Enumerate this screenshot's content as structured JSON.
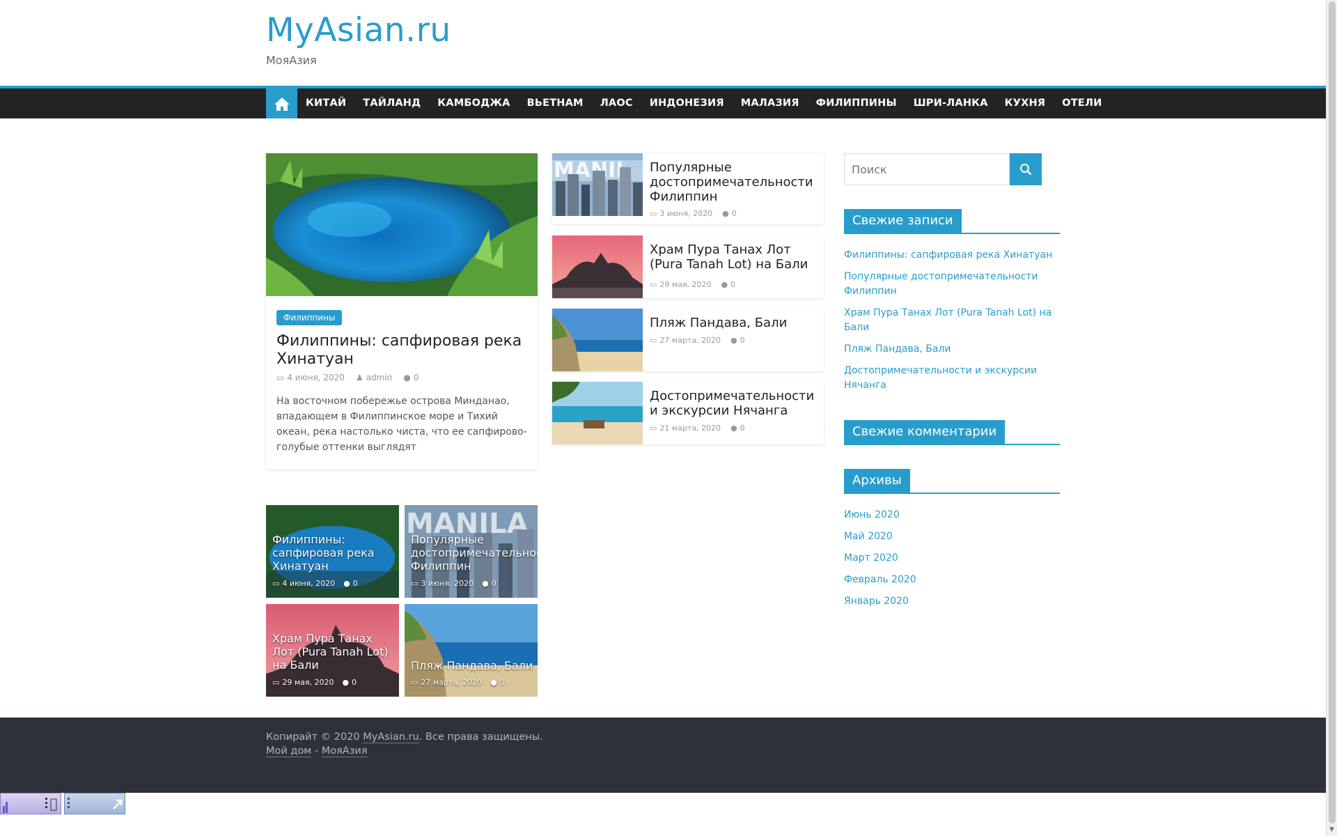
{
  "site": {
    "title": "MyAsian.ru",
    "description": "МояАзия"
  },
  "nav": {
    "items": [
      "КИТАЙ",
      "ТАЙЛАНД",
      "КАМБОДЖА",
      "ВЬЕТНАМ",
      "ЛАОС",
      "ИНДОНЕЗИЯ",
      "МАЛАЗИЯ",
      "ФИЛИППИНЫ",
      "ШРИ-ЛАНКА",
      "КУХНЯ",
      "ОТЕЛИ"
    ]
  },
  "featured": {
    "category": "Филиппины",
    "title": "Филиппины: сапфировая река Хинатуан",
    "date": "4 июня, 2020",
    "author": "admin",
    "comments": "0",
    "excerpt": "На восточном побережье острова Минданао, впадающем в Филиппинское море и Тихий океан, река настолько чиста, что ее сапфирово-голубые оттенки выглядят"
  },
  "side_posts": [
    {
      "title": "Популярные достопримечательности Филиппин",
      "date": "3 июня, 2020",
      "comments": "0"
    },
    {
      "title": "Храм Пура Танах Лот (Pura Tanah Lot) на Бали",
      "date": "29 мая, 2020",
      "comments": "0"
    },
    {
      "title": "Пляж Пандава, Бали",
      "date": "27 марта, 2020",
      "comments": "0"
    },
    {
      "title": "Достопримечательности и экскурсии Нячанга",
      "date": "21 марта, 2020",
      "comments": "0"
    }
  ],
  "grid_posts": [
    {
      "title": "Филиппины: сапфировая река Хинатуан",
      "date": "4 июня, 2020",
      "comments": "0"
    },
    {
      "title": "Популярные достопримечательности Филиппин",
      "date": "3 июня, 2020",
      "comments": "0"
    },
    {
      "title": "Храм Пура Танах Лот (Pura Tanah Lot) на Бали",
      "date": "29 мая, 2020",
      "comments": "0"
    },
    {
      "title": "Пляж Пандава, Бали",
      "date": "27 марта, 2020",
      "comments": "0"
    }
  ],
  "sidebar": {
    "search_placeholder": "Поиск",
    "recent_posts_title": "Свежие записи",
    "recent_posts": [
      "Филиппины: сапфировая река Хинатуан",
      "Популярные достопримечательности Филиппин",
      "Храм Пура Танах Лот (Pura Tanah Lot) на Бали",
      "Пляж Пандава, Бали",
      "Достопримечательности и экскурсии Нячанга"
    ],
    "recent_comments_title": "Свежие комментарии",
    "archives_title": "Архивы",
    "archives": [
      "Июнь 2020",
      "Май 2020",
      "Март 2020",
      "Февраль 2020",
      "Январь 2020"
    ]
  },
  "footer": {
    "copyright_prefix": "Копирайт © 2020",
    "site_link": "MyAsian.ru",
    "rights": ". Все права защищены.",
    "home_link": "Мой дом",
    "separator": "-",
    "tagline_link": "МояАзия"
  },
  "colors": {
    "accent": "#289dcc",
    "nav_bg": "#232323",
    "footer_bg": "#2f313a"
  }
}
